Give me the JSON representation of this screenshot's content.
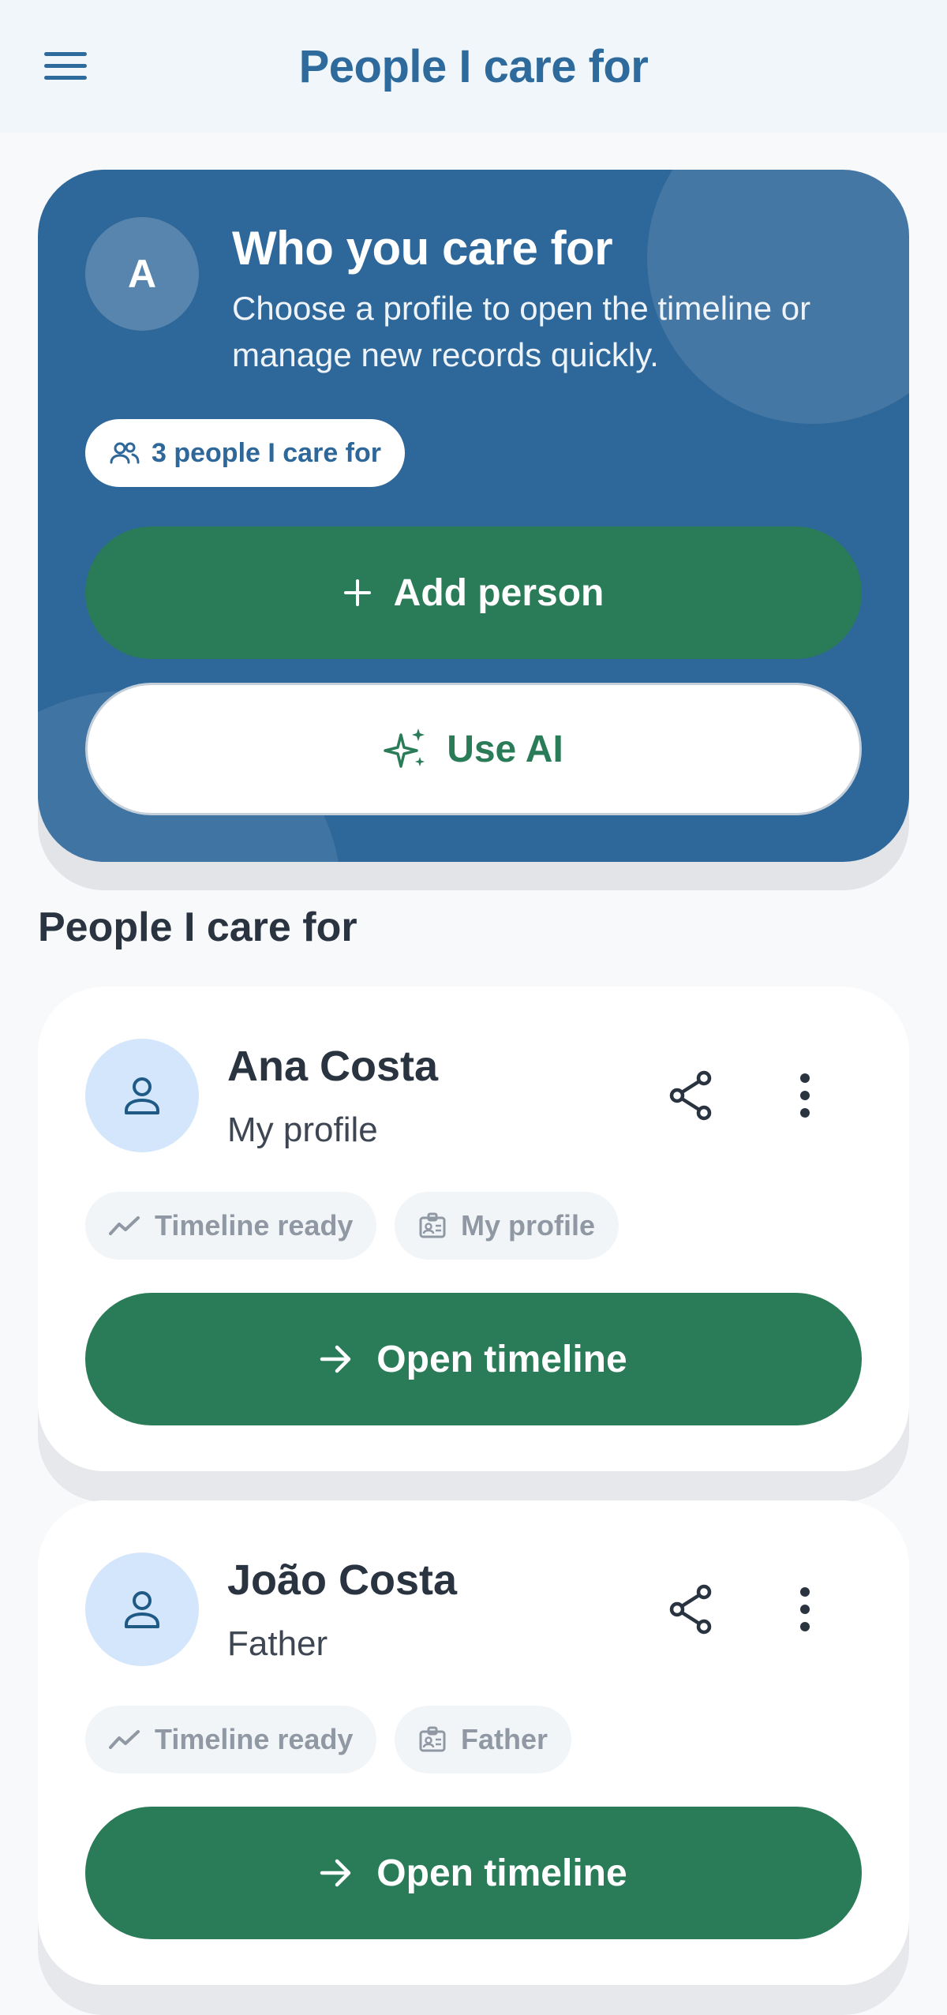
{
  "header": {
    "title": "People I care for",
    "menu_icon": "menu-icon"
  },
  "hero": {
    "avatar_initial": "A",
    "title": "Who you care for",
    "subtitle": "Choose a profile to open the timeline or manage new records quickly.",
    "count_chip": "3 people I care for",
    "add_button": "Add person",
    "ai_button": "Use AI",
    "colors": {
      "background": "#2e6799",
      "primary": "#2a7b57"
    }
  },
  "section": {
    "title": "People I care for"
  },
  "people": [
    {
      "name": "Ana Costa",
      "relation": "My profile",
      "chips": [
        "Timeline ready",
        "My profile"
      ],
      "open_label": "Open timeline"
    },
    {
      "name": "João Costa",
      "relation": "Father",
      "chips": [
        "Timeline ready",
        "Father"
      ],
      "open_label": "Open timeline"
    }
  ]
}
